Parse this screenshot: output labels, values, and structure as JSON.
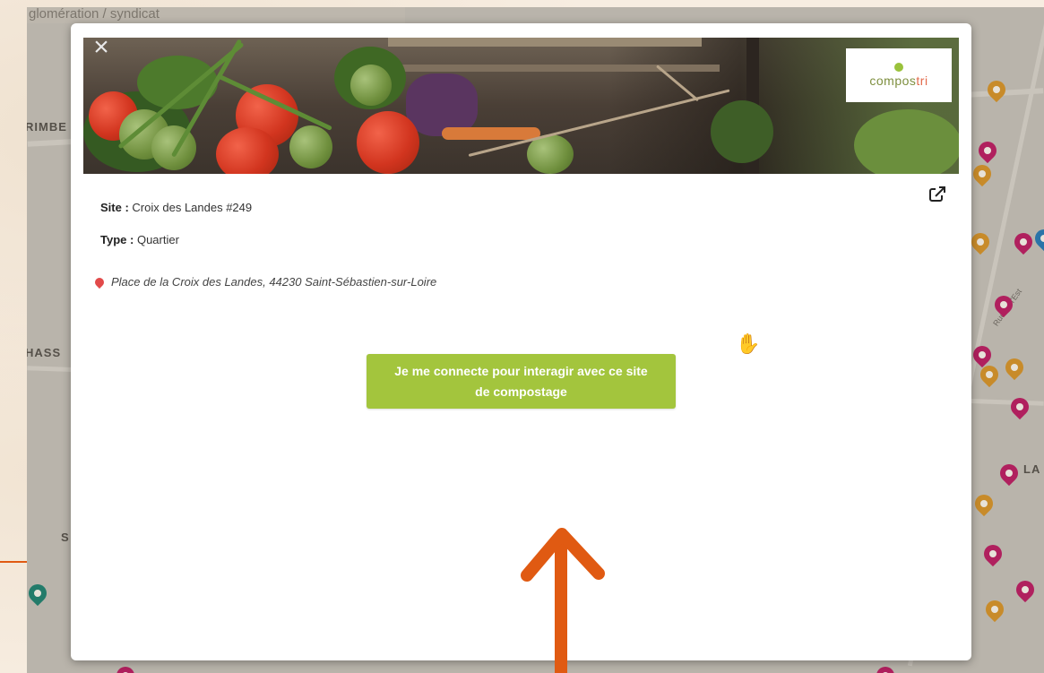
{
  "map": {
    "top_text": "glomération / syndicat",
    "labels": [
      "RIMBE",
      "HASS",
      "S",
      "LA"
    ],
    "street": "Rue de l'Est"
  },
  "modal": {
    "close_glyph": "×",
    "brand": {
      "name_part1": "compos",
      "name_part2": "tri"
    },
    "site_label": "Site :",
    "site_value": "Croix des Landes #249",
    "type_label": "Type :",
    "type_value": "Quartier",
    "address": "Place de la Croix des Landes, 44230 Saint-Sébastien-sur-Loire",
    "cta_label": "Je me connecte pour interagir avec ce site de compostage",
    "hand_glyph": "✋"
  },
  "icons": {
    "close": "close-icon",
    "external": "external-link-icon",
    "location": "location-pin-icon",
    "hand": "grab-hand-icon",
    "arrow": "annotation-arrow-icon"
  },
  "colors": {
    "cta": "#a3c53d",
    "annotation_arrow": "#e05a12",
    "pin_magenta": "#b0205e",
    "pin_orange": "#c88b2a",
    "pin_teal": "#237b6a"
  }
}
